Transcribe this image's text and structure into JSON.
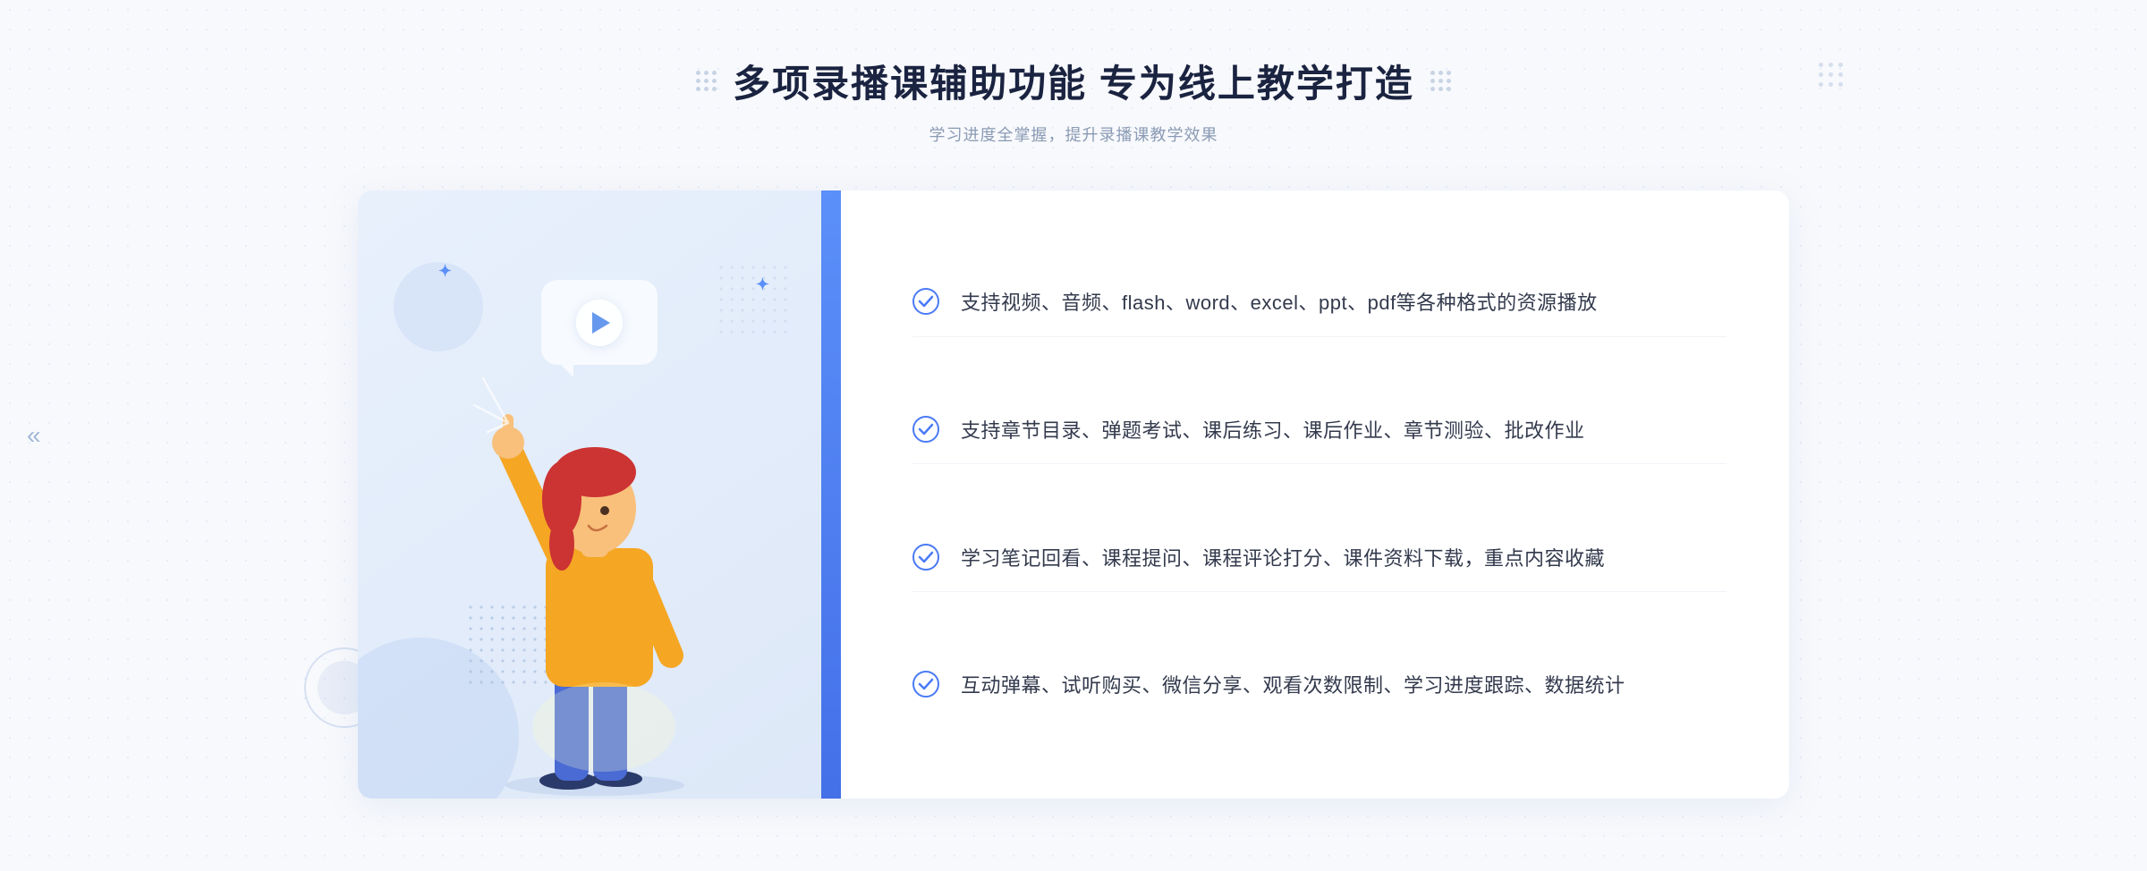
{
  "header": {
    "title": "多项录播课辅助功能 专为线上教学打造",
    "subtitle": "学习进度全掌握，提升录播课教学效果",
    "title_deco_left": "decorative-dots",
    "title_deco_right": "decorative-dots"
  },
  "features": [
    {
      "id": 1,
      "text": "支持视频、音频、flash、word、excel、ppt、pdf等各种格式的资源播放"
    },
    {
      "id": 2,
      "text": "支持章节目录、弹题考试、课后练习、课后作业、章节测验、批改作业"
    },
    {
      "id": 3,
      "text": "学习笔记回看、课程提问、课程评论打分、课件资料下载，重点内容收藏"
    },
    {
      "id": 4,
      "text": "互动弹幕、试听购买、微信分享、观看次数限制、学习进度跟踪、数据统计"
    }
  ],
  "navigation": {
    "left_arrow": "«"
  },
  "colors": {
    "primary": "#4a7af5",
    "primary_light": "#6699ee",
    "text_dark": "#1a2340",
    "text_gray": "#8a9bb5",
    "text_body": "#333a4d",
    "bg_light": "#f8f9fc",
    "bg_illustration": "#e8f0fc",
    "check_color": "#4a7af5"
  }
}
